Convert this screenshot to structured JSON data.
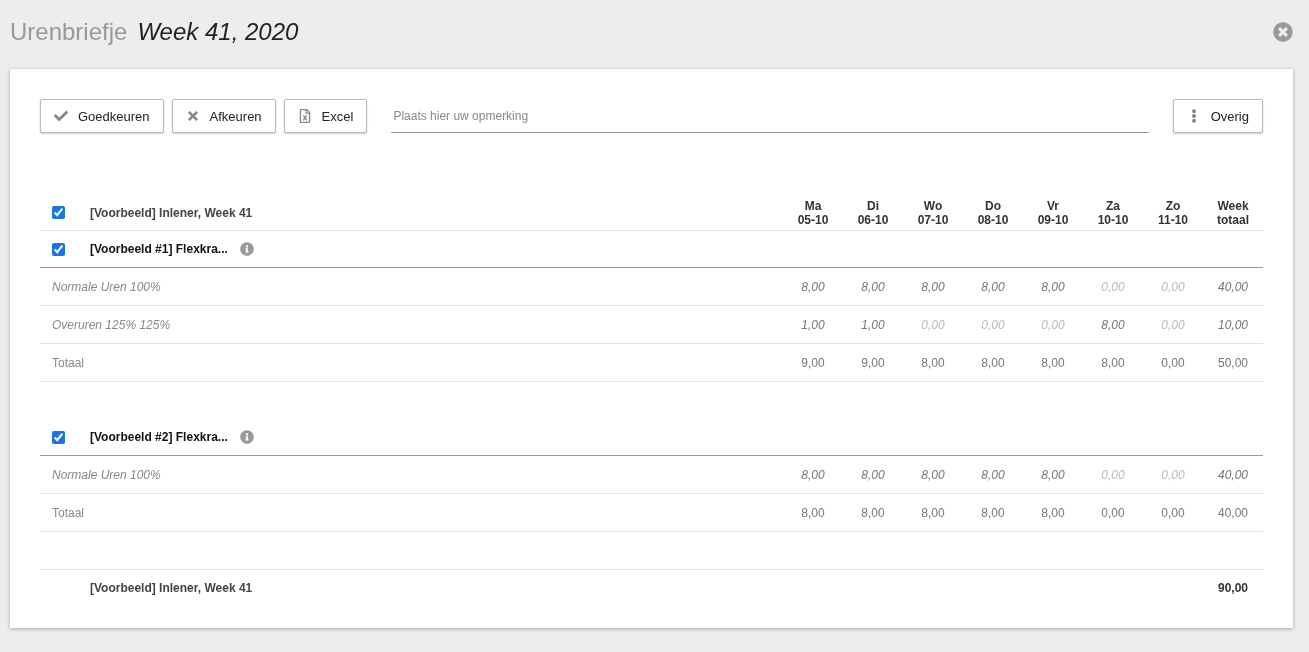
{
  "title": "Urenbriefje",
  "subtitle": "Week 41, 2020",
  "toolbar": {
    "buttons": [
      {
        "kind": "approve",
        "label": "Goedkeuren"
      },
      {
        "kind": "reject",
        "label": "Afkeuren"
      },
      {
        "kind": "excel",
        "label": "Excel"
      }
    ],
    "remark": {
      "placeholder": "Plaats hier uw opmerking"
    },
    "more": {
      "label": "Overig"
    }
  },
  "table": {
    "header": {
      "checked": true,
      "label": "[Voorbeeld] Inlener, Week 41",
      "columns": [
        [
          "Ma",
          "05-10"
        ],
        [
          "Di",
          "06-10"
        ],
        [
          "Wo",
          "07-10"
        ],
        [
          "Do",
          "08-10"
        ],
        [
          "Vr",
          "09-10"
        ],
        [
          "Za",
          "10-10"
        ],
        [
          "Zo",
          "11-10"
        ],
        [
          "Week",
          "totaal"
        ]
      ]
    },
    "groups": [
      {
        "checked": true,
        "name": "[Voorbeeld #1] Flexkra...",
        "rows": [
          {
            "kind": "hours",
            "label": "Normale Uren 100%",
            "cells": [
              {
                "text": "8,00",
                "muted": false
              },
              {
                "text": "8,00",
                "muted": false
              },
              {
                "text": "8,00",
                "muted": false
              },
              {
                "text": "8,00",
                "muted": false
              },
              {
                "text": "8,00",
                "muted": false
              },
              {
                "text": "0,00",
                "muted": true
              },
              {
                "text": "0,00",
                "muted": true
              },
              {
                "text": "40,00",
                "muted": false
              }
            ]
          },
          {
            "kind": "hours",
            "label": "Overuren 125% 125%",
            "cells": [
              {
                "text": "1,00",
                "muted": false
              },
              {
                "text": "1,00",
                "muted": false
              },
              {
                "text": "0,00",
                "muted": true
              },
              {
                "text": "0,00",
                "muted": true
              },
              {
                "text": "0,00",
                "muted": true
              },
              {
                "text": "8,00",
                "muted": false
              },
              {
                "text": "0,00",
                "muted": true
              },
              {
                "text": "10,00",
                "muted": false
              }
            ]
          },
          {
            "kind": "total",
            "label": "Totaal",
            "cells": [
              {
                "text": "9,00",
                "muted": false
              },
              {
                "text": "9,00",
                "muted": false
              },
              {
                "text": "8,00",
                "muted": false
              },
              {
                "text": "8,00",
                "muted": false
              },
              {
                "text": "8,00",
                "muted": false
              },
              {
                "text": "8,00",
                "muted": false
              },
              {
                "text": "0,00",
                "muted": false
              },
              {
                "text": "50,00",
                "muted": false
              }
            ]
          }
        ]
      },
      {
        "checked": true,
        "name": "[Voorbeeld #2] Flexkra...",
        "rows": [
          {
            "kind": "hours",
            "label": "Normale Uren 100%",
            "cells": [
              {
                "text": "8,00",
                "muted": false
              },
              {
                "text": "8,00",
                "muted": false
              },
              {
                "text": "8,00",
                "muted": false
              },
              {
                "text": "8,00",
                "muted": false
              },
              {
                "text": "8,00",
                "muted": false
              },
              {
                "text": "0,00",
                "muted": true
              },
              {
                "text": "0,00",
                "muted": true
              },
              {
                "text": "40,00",
                "muted": false
              }
            ]
          },
          {
            "kind": "total",
            "label": "Totaal",
            "cells": [
              {
                "text": "8,00",
                "muted": false
              },
              {
                "text": "8,00",
                "muted": false
              },
              {
                "text": "8,00",
                "muted": false
              },
              {
                "text": "8,00",
                "muted": false
              },
              {
                "text": "8,00",
                "muted": false
              },
              {
                "text": "0,00",
                "muted": false
              },
              {
                "text": "0,00",
                "muted": false
              },
              {
                "text": "40,00",
                "muted": false
              }
            ]
          }
        ]
      }
    ],
    "footer": {
      "label": "[Voorbeeld] Inlener, Week 41",
      "total": "90,00"
    }
  }
}
